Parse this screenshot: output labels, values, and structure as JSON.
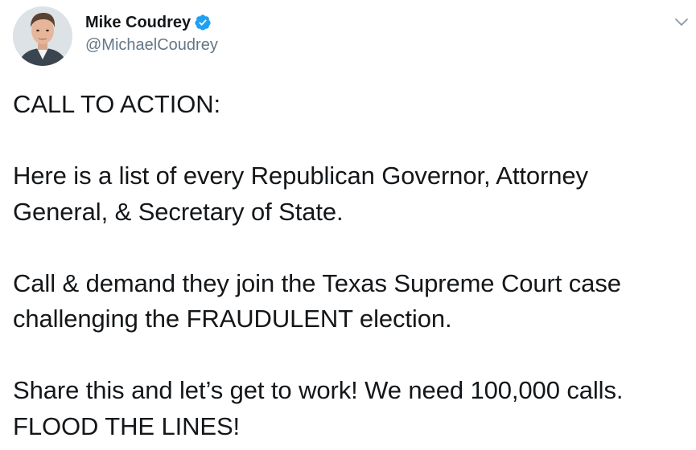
{
  "author": {
    "display_name": "Mike Coudrey",
    "handle": "@MichaelCoudrey",
    "verified": true,
    "avatar_icon": "profile-photo"
  },
  "tweet": {
    "lines": [
      "CALL TO ACTION:",
      "",
      "Here is a list of every Republican Governor, Attorney",
      "General, & Secretary of State.",
      "",
      "Call & demand they join the Texas Supreme Court case",
      "challenging the FRAUDULENT election.",
      "",
      "Share this and let’s get to work! We need 100,000 calls.",
      "FLOOD THE LINES!"
    ]
  },
  "menu": {
    "icon": "chevron-down-icon"
  },
  "colors": {
    "verified_blue": "#1da1f2",
    "text_primary": "#14171a",
    "text_secondary": "#657786"
  }
}
